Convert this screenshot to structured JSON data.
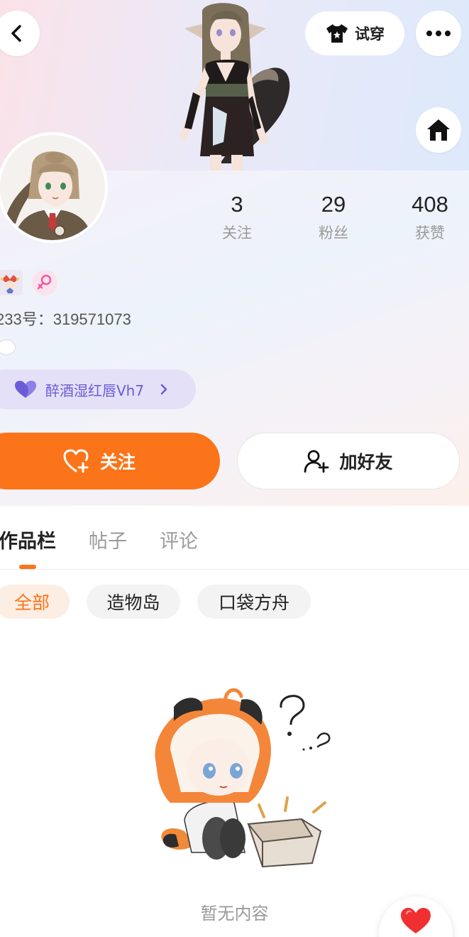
{
  "header": {
    "tryon_label": "试穿"
  },
  "stats": [
    {
      "num": "3",
      "label": "关注"
    },
    {
      "num": "29",
      "label": "粉丝"
    },
    {
      "num": "408",
      "label": "获赞"
    }
  ],
  "profile": {
    "uid": "233号：319571073",
    "club_chip": "醉酒湿红唇Vh7"
  },
  "actions": {
    "follow_label": "关注",
    "add_friend_label": "加好友"
  },
  "tabs": [
    {
      "label": "作品栏",
      "active": true
    },
    {
      "label": "帖子",
      "active": false
    },
    {
      "label": "评论",
      "active": false
    }
  ],
  "filters": [
    {
      "label": "全部",
      "active": true
    },
    {
      "label": "造物岛",
      "active": false
    },
    {
      "label": "口袋方舟",
      "active": false
    }
  ],
  "empty": {
    "text": "暂无内容"
  },
  "colors": {
    "accent": "#fb7419",
    "chip_purple": "#6b5bd6"
  }
}
